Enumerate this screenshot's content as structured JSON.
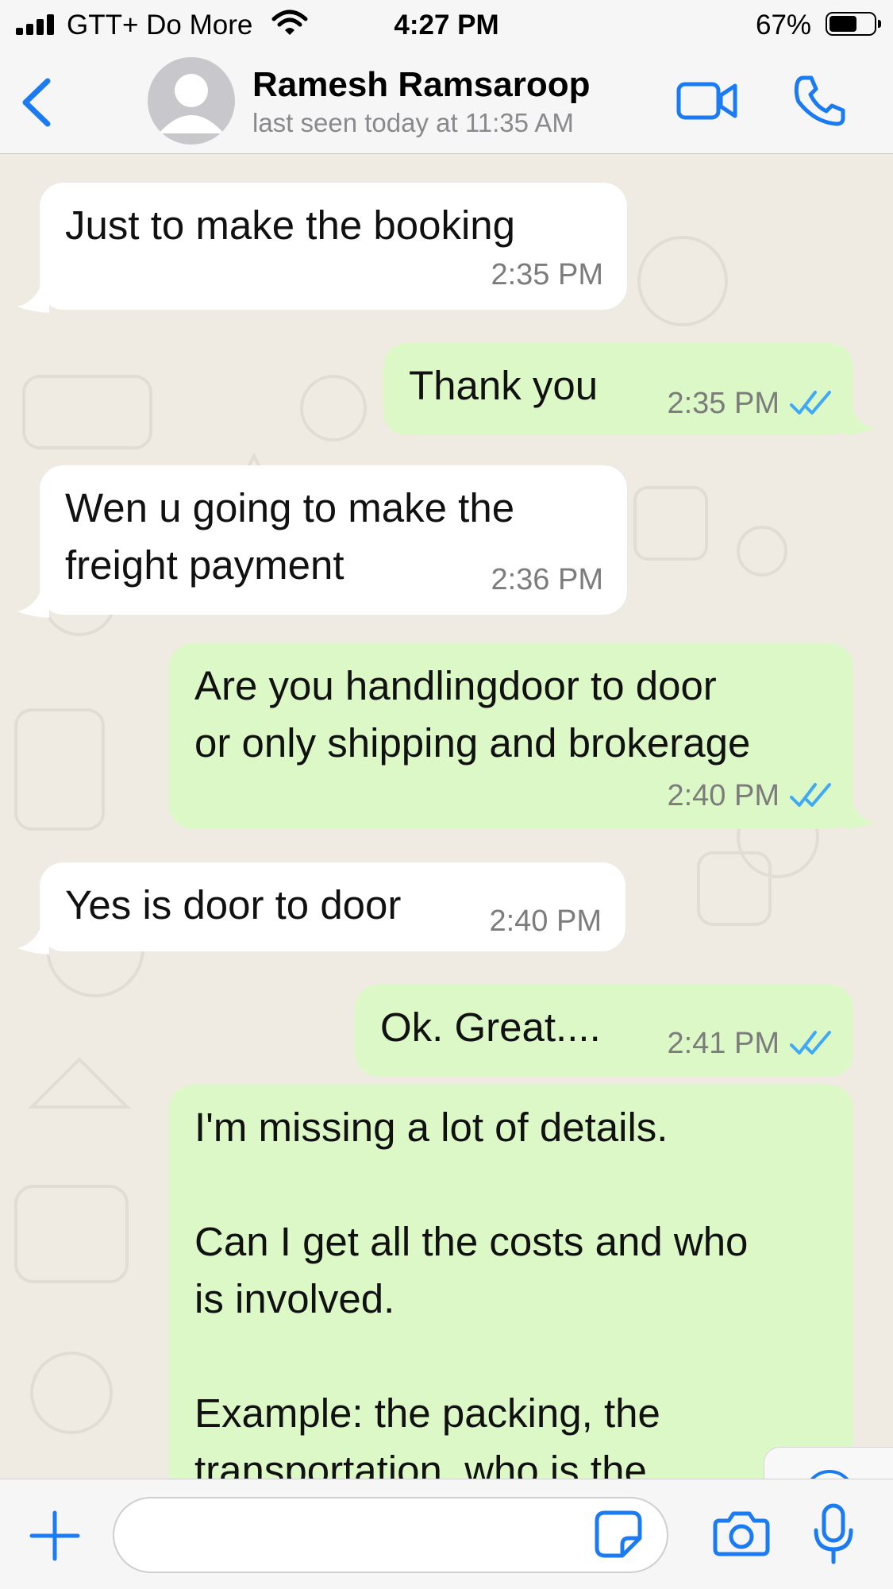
{
  "status_bar": {
    "carrier": "GTT+ Do More",
    "time": "4:27 PM",
    "battery_percent": "67%",
    "battery_level": 0.67
  },
  "header": {
    "contact_name": "Ramesh Ramsaroop",
    "last_seen": "last seen today at 11:35 AM",
    "icons": [
      "chevron-left-icon",
      "avatar-placeholder-icon",
      "video-camera-icon",
      "phone-icon"
    ]
  },
  "messages": [
    {
      "direction": "in",
      "text": "Just to make the booking",
      "time": "2:35 PM"
    },
    {
      "direction": "out",
      "text": "Thank you",
      "time": "2:35 PM",
      "status": "read"
    },
    {
      "direction": "in",
      "text": "Wen u going to make the\nfreight payment",
      "time": "2:36 PM"
    },
    {
      "direction": "out",
      "text": "Are you handlingdoor to door\nor only shipping and brokerage",
      "time": "2:40 PM",
      "status": "read"
    },
    {
      "direction": "in",
      "text": "Yes is door to door",
      "time": "2:40 PM"
    },
    {
      "direction": "out",
      "text": "Ok. Great....",
      "time": "2:41 PM",
      "status": "read"
    },
    {
      "direction": "out",
      "text": "I'm missing a lot of details.\n\nCan I get all the costs and who\nis involved.\n\nExample: the packing, the\ntransportation, who is the",
      "time": "",
      "status": ""
    }
  ],
  "input_bar": {
    "placeholder": "",
    "icons": [
      "plus-icon",
      "sticker-icon",
      "camera-icon",
      "microphone-icon"
    ]
  },
  "scroll_button": {
    "icon": "chevron-down-circle-icon"
  },
  "colors": {
    "accent": "#1a7bf2",
    "incoming_bubble": "#ffffff",
    "outgoing_bubble": "#dcf8c6",
    "read_ticks": "#3fa9f5",
    "wallpaper": "#efeae2"
  }
}
